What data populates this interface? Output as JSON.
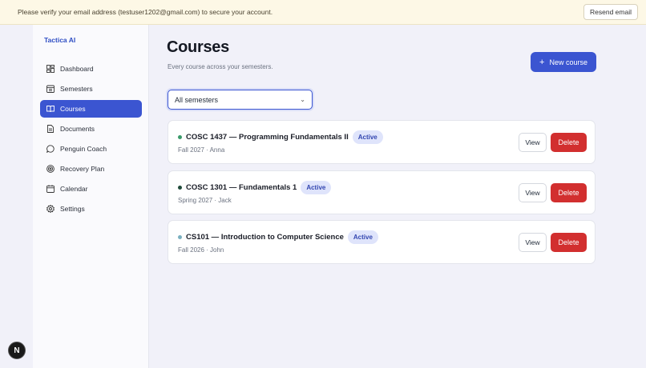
{
  "banner": {
    "message": "Please verify your email address (testuser1202@gmail.com) to secure your account.",
    "resend_label": "Resend email"
  },
  "sidebar": {
    "brand": "Tactica AI",
    "items": [
      {
        "label": "Dashboard",
        "icon": "dashboard-icon",
        "active": false
      },
      {
        "label": "Semesters",
        "icon": "calendar-grid-icon",
        "active": false
      },
      {
        "label": "Courses",
        "icon": "book-icon",
        "active": true
      },
      {
        "label": "Documents",
        "icon": "document-icon",
        "active": false
      },
      {
        "label": "Penguin Coach",
        "icon": "chat-bubble-icon",
        "active": false
      },
      {
        "label": "Recovery Plan",
        "icon": "target-icon",
        "active": false
      },
      {
        "label": "Calendar",
        "icon": "calendar-icon",
        "active": false
      },
      {
        "label": "Settings",
        "icon": "gear-icon",
        "active": false
      }
    ]
  },
  "main": {
    "title": "Courses",
    "subtitle": "Every course across your semesters.",
    "new_course_label": "New course",
    "filter": {
      "selected": "All semesters"
    },
    "courses": [
      {
        "name": "COSC 1437 — Programming Fundamentals II",
        "status": "Active",
        "meta": "Fall 2027 · Anna",
        "dot_color": "#3a9a6a",
        "view_label": "View",
        "delete_label": "Delete"
      },
      {
        "name": "COSC 1301 — Fundamentals 1",
        "status": "Active",
        "meta": "Spring 2027 · Jack",
        "dot_color": "#1f4a3a",
        "view_label": "View",
        "delete_label": "Delete"
      },
      {
        "name": "CS101 — Introduction to Computer Science",
        "status": "Active",
        "meta": "Fall 2026 · John",
        "dot_color": "#7ab0c0",
        "view_label": "View",
        "delete_label": "Delete"
      }
    ]
  },
  "dev_indicator": {
    "letter": "N"
  },
  "colors": {
    "accent": "#3b55d1",
    "danger": "#d22f2f",
    "banner_bg": "#fdf8e6",
    "badge_bg": "#dfe4fb"
  }
}
